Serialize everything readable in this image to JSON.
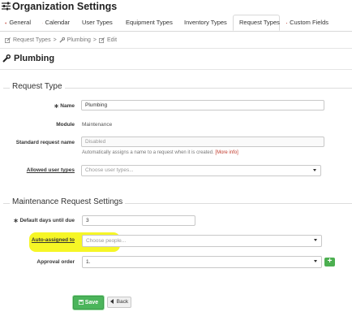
{
  "header": {
    "title": "Organization Settings"
  },
  "tabs": [
    {
      "label": "General",
      "icon": "gear-icon",
      "color": "#c0392b"
    },
    {
      "label": "Calendar",
      "icon": "calendar-icon",
      "color": "#c0392b"
    },
    {
      "label": "User Types",
      "icon": "users-icon",
      "color": "#c0392b"
    },
    {
      "label": "Equipment Types",
      "icon": "toolbox-icon",
      "color": "#c0392b"
    },
    {
      "label": "Inventory Types",
      "icon": "cogs-icon",
      "color": "#c0392b"
    },
    {
      "label": "Request Types",
      "icon": "edit-icon",
      "color": "#555555",
      "active": true
    },
    {
      "label": "Custom Fields",
      "icon": "list-icon",
      "color": "#c0392b"
    }
  ],
  "breadcrumb": {
    "item1": "Request Types",
    "item2": "Plumbing",
    "item3": "Edit",
    "separator": ">"
  },
  "page": {
    "title": "Plumbing"
  },
  "request_type": {
    "legend": "Request Type",
    "name_label": "Name",
    "name_value": "Plumbing",
    "module_label": "Module",
    "module_value": "Maintenance",
    "std_name_label": "Standard request name",
    "std_name_value": "Disabled",
    "std_name_help": "Automatically assigns a name to a request when it is created.",
    "std_name_help_link": "[More info]",
    "allowed_label": "Allowed user types",
    "allowed_placeholder": "Choose user types..."
  },
  "maintenance": {
    "legend": "Maintenance Request Settings",
    "days_label": "Default days until due",
    "days_value": "3",
    "auto_label": "Auto-assigned to",
    "auto_placeholder": "Choose people...",
    "approval_label": "Approval order",
    "approval_value": "1.",
    "add_label": "+"
  },
  "actions": {
    "save": "Save",
    "back": "Back"
  },
  "colors": {
    "accent_red": "#c0392b",
    "save_green": "#4bb55b",
    "highlight_yellow": "#f5f500"
  }
}
